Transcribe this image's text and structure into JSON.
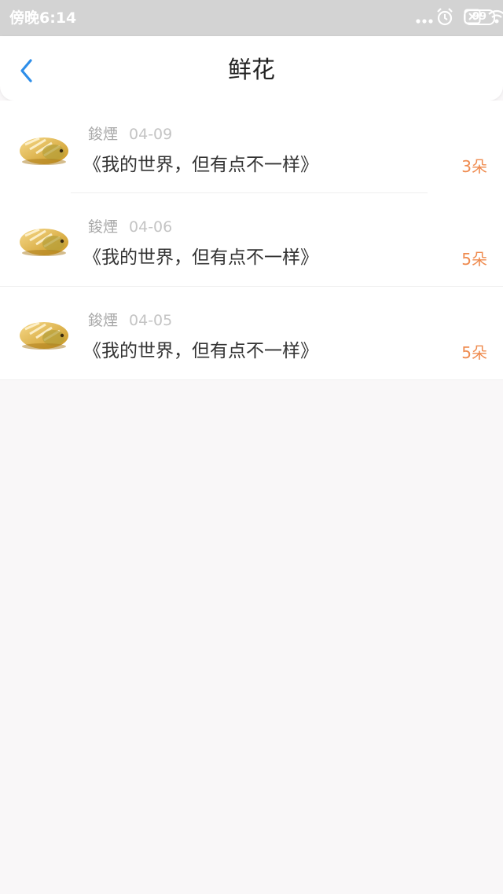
{
  "status_bar": {
    "time": "傍晚6:14",
    "battery": "99",
    "icons": [
      "more-dots-icon",
      "alarm-icon",
      "sim-icon",
      "wifi-icon",
      "battery-icon"
    ]
  },
  "header": {
    "title": "鲜花",
    "back_icon": "chevron-left-icon",
    "accent_color": "#2e8ee9"
  },
  "records": [
    {
      "user": "鋑煙",
      "date": "04-09",
      "book": "《我的世界，但有点不一样》",
      "count": "3朵"
    },
    {
      "user": "鋑煙",
      "date": "04-06",
      "book": "《我的世界，但有点不一样》",
      "count": "5朵"
    },
    {
      "user": "鋑煙",
      "date": "04-05",
      "book": "《我的世界，但有点不一样》",
      "count": "5朵"
    }
  ],
  "colors": {
    "count": "#ef8b4f",
    "status_bar_bg": "#d3d3d3",
    "page_bg": "#f9f7f8"
  }
}
